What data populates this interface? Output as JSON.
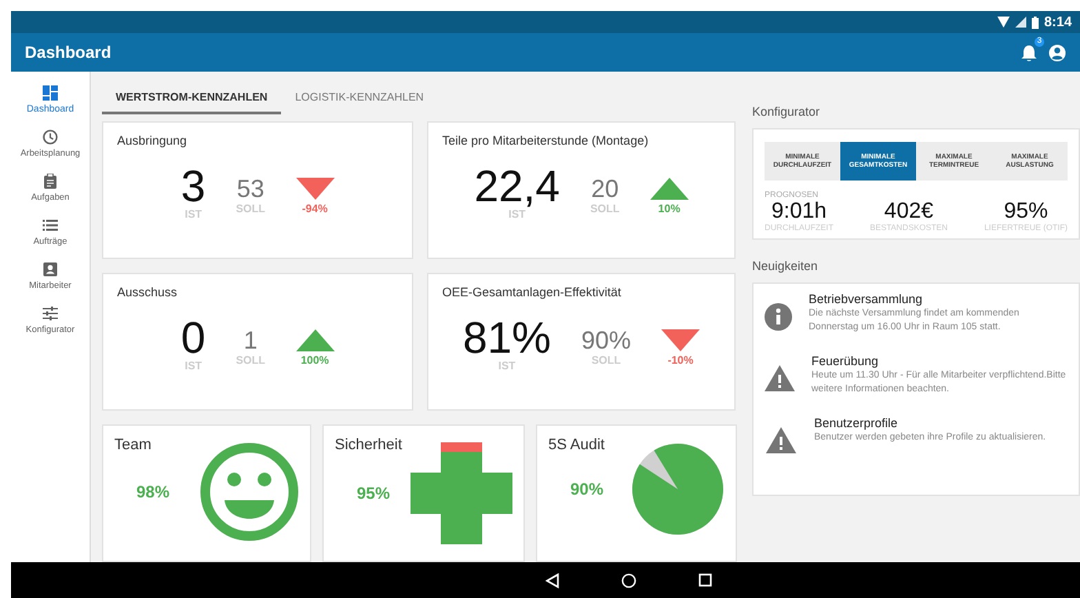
{
  "status_bar": {
    "time": "8:14"
  },
  "toolbar": {
    "title": "Dashboard",
    "notification_count": "3"
  },
  "sidebar": {
    "items": [
      {
        "label": "Dashboard",
        "selected": true
      },
      {
        "label": "Arbeitsplanung",
        "selected": false
      },
      {
        "label": "Aufgaben",
        "selected": false
      },
      {
        "label": "Aufträge",
        "selected": false
      },
      {
        "label": "Mitarbeiter",
        "selected": false
      },
      {
        "label": "Konfigurator",
        "selected": false
      }
    ]
  },
  "tabs": [
    {
      "label": "WERTSTROM-KENNZAHLEN",
      "selected": true
    },
    {
      "label": "LOGISTIK-KENNZAHLEN",
      "selected": false
    }
  ],
  "kpis": [
    {
      "title": "Ausbringung",
      "actual": "3",
      "actual_label": "IST",
      "target": "53",
      "target_label": "SOLL",
      "kind": "down",
      "change": "-94%"
    },
    {
      "title": "Teile pro Mitarbeiterstunde (Montage)",
      "actual": "22,4",
      "actual_label": "IST",
      "target": "20",
      "target_label": "SOLL",
      "kind": "up",
      "change": "10%"
    },
    {
      "title": "Ausschuss",
      "actual": "0",
      "actual_label": "IST",
      "target": "1",
      "target_label": "SOLL",
      "kind": "up",
      "change": "100%"
    },
    {
      "title": "OEE-Gesamtanlagen-Effektivität",
      "actual": "81%",
      "actual_label": "IST",
      "target": "90%",
      "target_label": "SOLL",
      "kind": "down",
      "change": "-10%"
    }
  ],
  "gauges": [
    {
      "kind": "smiley",
      "title": "Team",
      "value": "98%"
    },
    {
      "kind": "cross",
      "title": "Sicherheit",
      "value": "95%",
      "level": 0.9
    },
    {
      "kind": "pie",
      "title": "5S Audit",
      "value": "90%",
      "level": 0.93
    }
  ],
  "configurator": {
    "title": "Konfigurator",
    "options": [
      {
        "label": "MINIMALE DURCHLAUFZEIT",
        "selected": false
      },
      {
        "label": "MINIMALE GESAMTKOSTEN",
        "selected": true
      },
      {
        "label": "MAXIMALE TERMINTREUE",
        "selected": false
      },
      {
        "label": "MAXIMALE AUSLASTUNG",
        "selected": false
      }
    ],
    "forecast_label": "PROGNOSEN",
    "forecasts": [
      {
        "value": "9:01h",
        "label": "DURCHLAUFZEIT"
      },
      {
        "value": "402€",
        "label": "BESTANDSKOSTEN"
      },
      {
        "value": "95%",
        "label": "LIEFERTREUE (OTIF)"
      }
    ]
  },
  "news": {
    "title": "Neuigkeiten",
    "items": [
      {
        "kind": "info",
        "title": "Betriebversammlung",
        "text": "Die nächste Versammlung findet am kommenden Donnerstag um 16.00 Uhr in Raum 105 statt."
      },
      {
        "kind": "warning",
        "title": "Feuerübung",
        "text": "Heute um 11.30 Uhr - Für alle Mitarbeiter verpflichtend.Bitte weitere Informationen beachten."
      },
      {
        "kind": "warning",
        "title": "Benutzerprofile",
        "text": "Benutzer werden gebeten ihre Profile zu aktualisieren."
      }
    ]
  }
}
